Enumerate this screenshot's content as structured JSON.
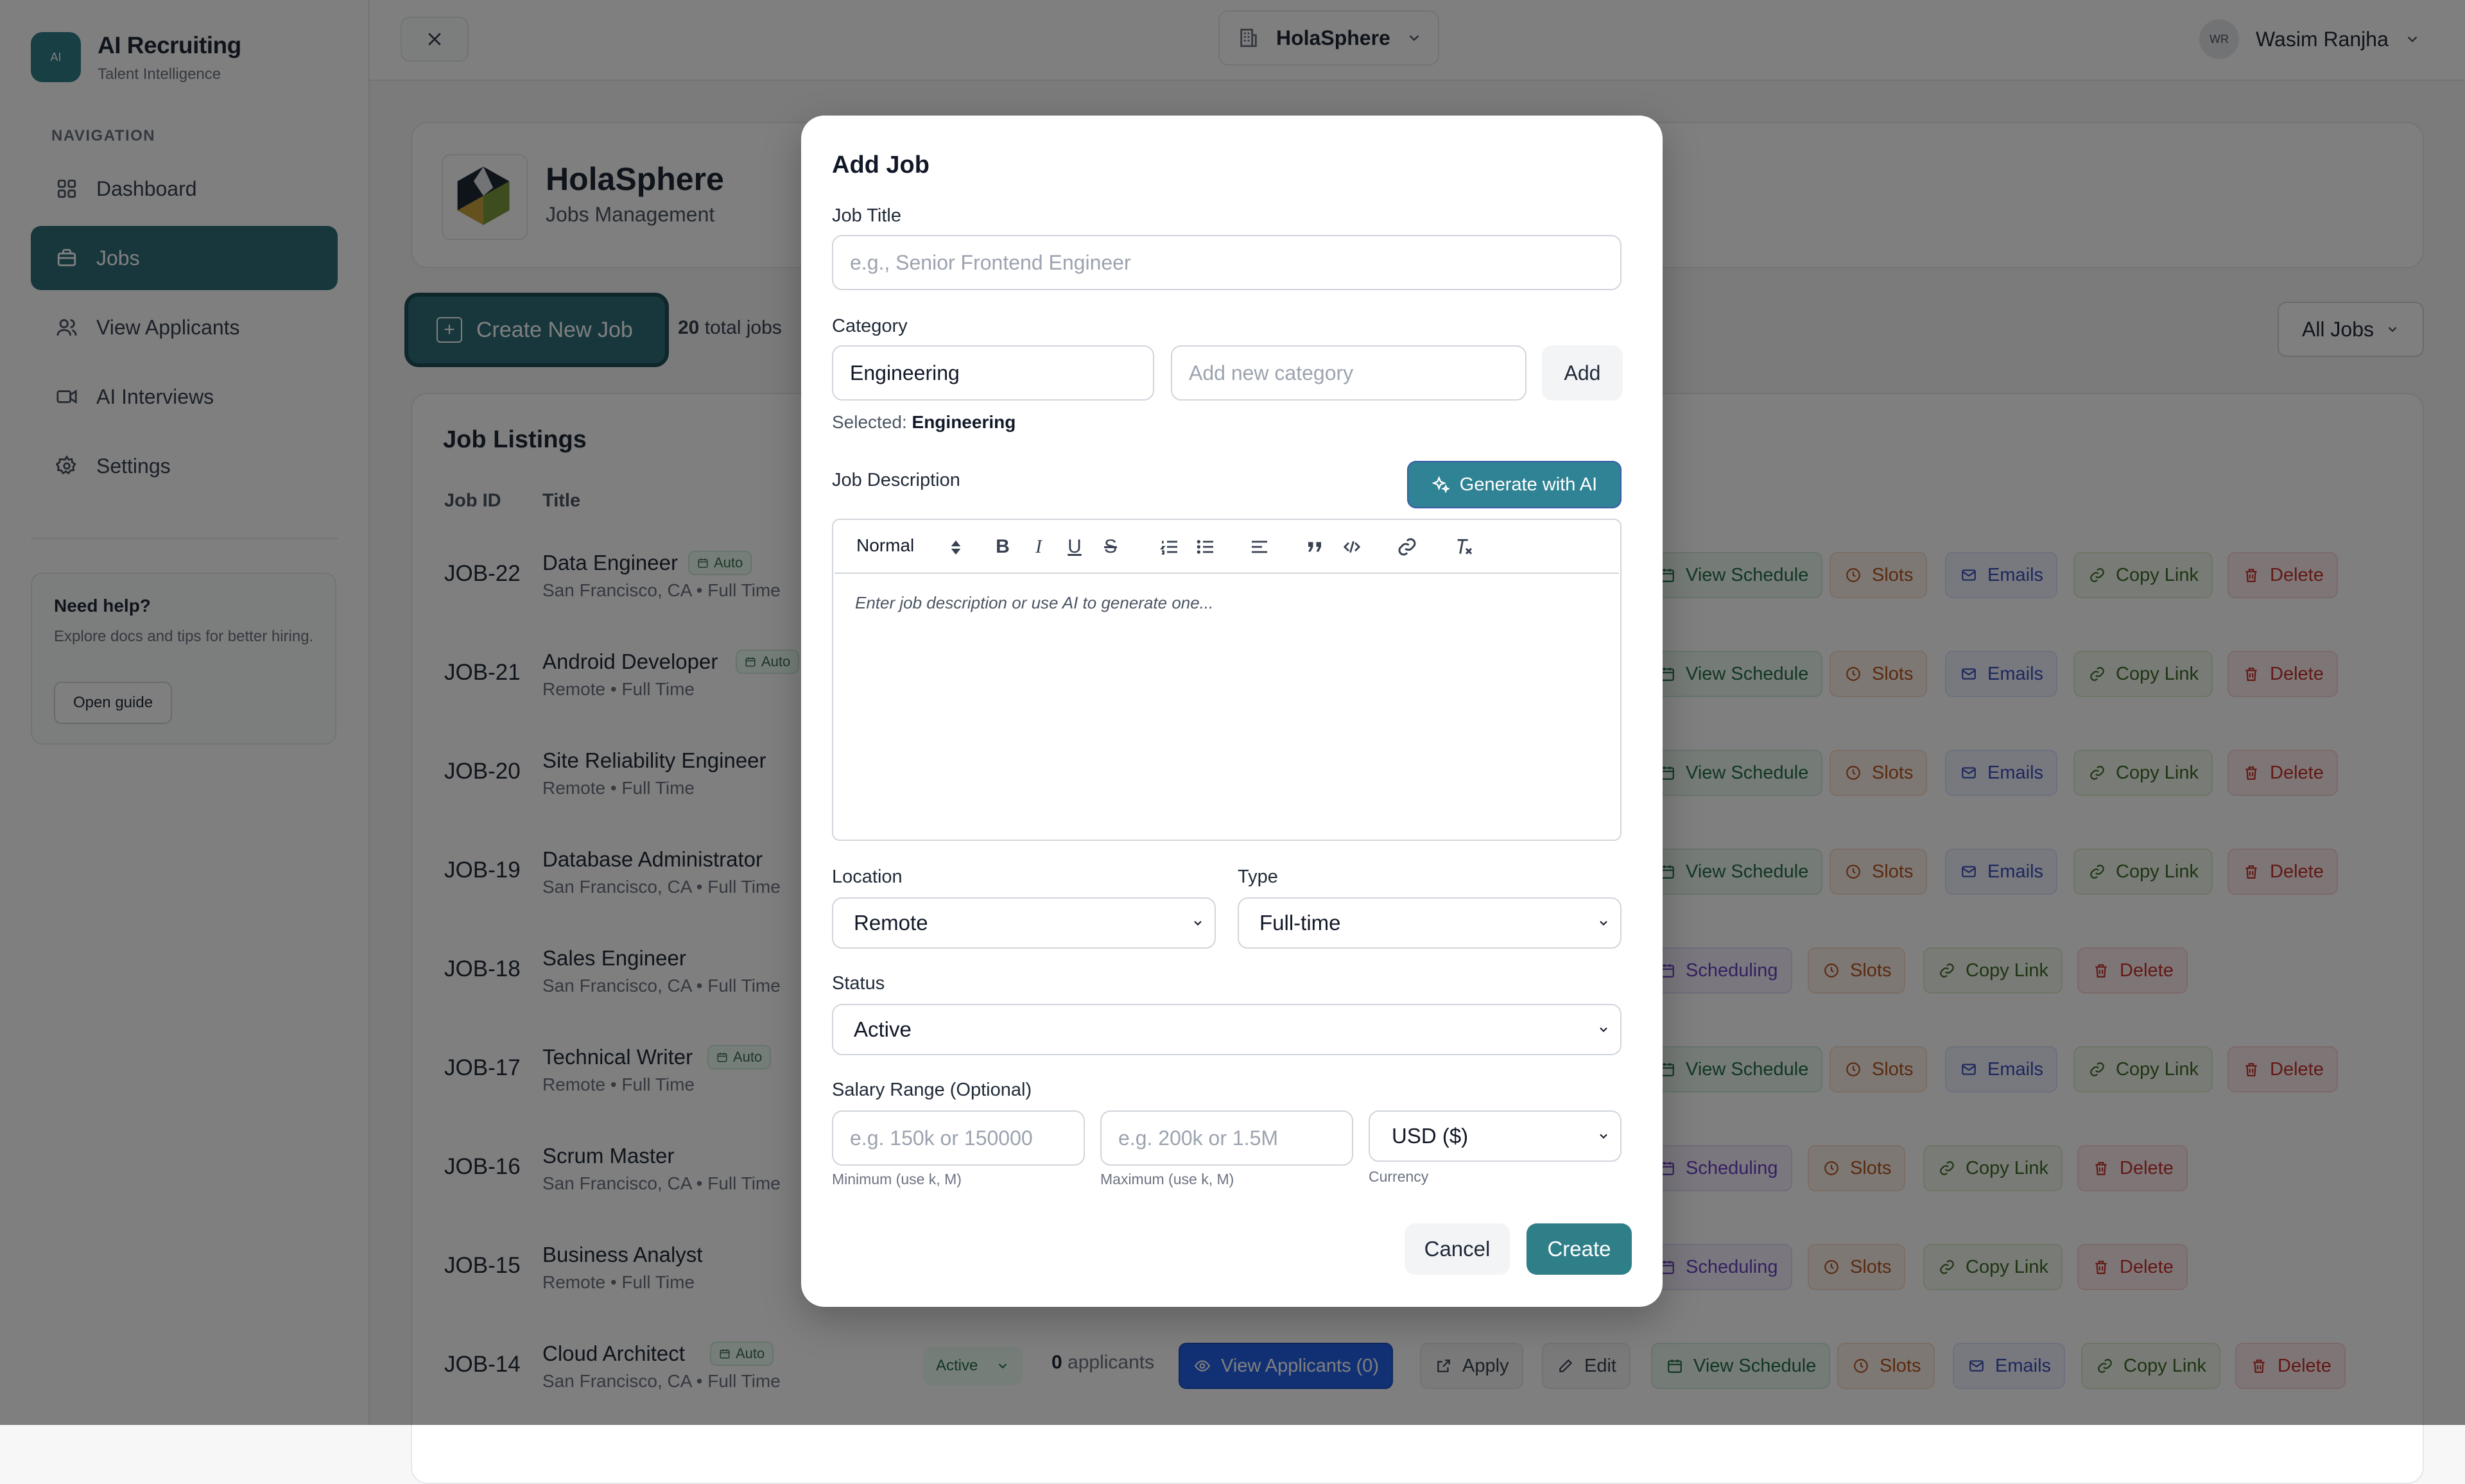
{
  "app": {
    "title": "AI Recruiting",
    "subtitle": "Talent Intelligence",
    "logo_text": "AI"
  },
  "sidebar": {
    "heading": "NAVIGATION",
    "items": [
      {
        "label": "Dashboard",
        "icon": "grid-icon"
      },
      {
        "label": "Jobs",
        "icon": "briefcase-icon",
        "active": true
      },
      {
        "label": "View Applicants",
        "icon": "users-icon"
      },
      {
        "label": "AI Interviews",
        "icon": "video-icon"
      },
      {
        "label": "Settings",
        "icon": "gear-icon"
      }
    ],
    "help": {
      "title": "Need help?",
      "text": "Explore docs and tips for better hiring.",
      "button": "Open guide"
    }
  },
  "topbar": {
    "company": "HolaSphere",
    "user_name": "Wasim Ranjha",
    "user_initials": "WR"
  },
  "header": {
    "title": "HolaSphere",
    "subtitle": "Jobs Management"
  },
  "toolbar": {
    "create_label": "Create New Job",
    "total_count": "20",
    "total_label": "total jobs",
    "filter": "All Jobs"
  },
  "listing": {
    "title": "Job Listings",
    "columns": [
      "Job ID",
      "Title"
    ],
    "rows": [
      {
        "id": "JOB-22",
        "title": "Data Engineer",
        "auto": "Auto",
        "meta": "San Francisco, CA • Full Time"
      },
      {
        "id": "JOB-21",
        "title": "Android Developer",
        "auto": "Auto",
        "meta": "Remote • Full Time"
      },
      {
        "id": "JOB-20",
        "title": "Site Reliability Engineer",
        "auto": "",
        "meta": "Remote • Full Time"
      },
      {
        "id": "JOB-19",
        "title": "Database Administrator",
        "auto": "",
        "meta": "San Francisco, CA • Full Time"
      },
      {
        "id": "JOB-18",
        "title": "Sales Engineer",
        "auto": "",
        "meta": "San Francisco, CA • Full Time"
      },
      {
        "id": "JOB-17",
        "title": "Technical Writer",
        "auto": "Auto",
        "meta": "Remote • Full Time"
      },
      {
        "id": "JOB-16",
        "title": "Scrum Master",
        "auto": "",
        "meta": "San Francisco, CA • Full Time"
      },
      {
        "id": "JOB-15",
        "title": "Business Analyst",
        "auto": "",
        "meta": "Remote • Full Time"
      },
      {
        "id": "JOB-14",
        "title": "Cloud Architect",
        "auto": "Auto",
        "meta": "San Francisco, CA • Full Time"
      }
    ],
    "actions": {
      "view_schedule": "View Schedule",
      "slots": "Slots",
      "emails": "Emails",
      "copy_link": "Copy Link",
      "delete": "Delete",
      "scheduling": "Scheduling",
      "edit": "Edit",
      "apply": "Apply",
      "view_applicants": "View Applicants (0)",
      "status": "Active",
      "applicants_count": "0",
      "applicants_label": "applicants"
    }
  },
  "modal": {
    "title": "Add Job",
    "job_title_label": "Job Title",
    "job_title_placeholder": "e.g., Senior Frontend Engineer",
    "category_label": "Category",
    "category_value": "Engineering",
    "new_category_placeholder": "Add new category",
    "add_button": "Add",
    "selected_prefix": "Selected:",
    "selected_value": "Engineering",
    "description_label": "Job Description",
    "generate_button": "Generate with AI",
    "editor_format": "Normal",
    "editor_placeholder": "Enter job description or use AI to generate one...",
    "location_label": "Location",
    "location_value": "Remote",
    "type_label": "Type",
    "type_value": "Full-time",
    "status_label": "Status",
    "status_value": "Active",
    "salary_label": "Salary Range (Optional)",
    "min_placeholder": "e.g. 150k or 150000",
    "max_placeholder": "e.g. 200k or 1.5M",
    "currency_value": "USD ($)",
    "min_hint": "Minimum (use k, M)",
    "max_hint": "Maximum (use k, M)",
    "currency_hint": "Currency",
    "cancel_button": "Cancel",
    "create_button": "Create"
  }
}
